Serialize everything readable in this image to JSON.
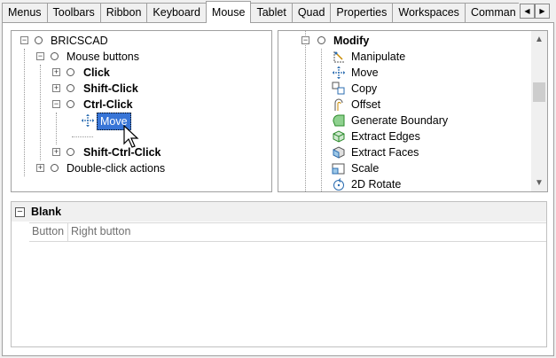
{
  "tabs": [
    "Menus",
    "Toolbars",
    "Ribbon",
    "Keyboard",
    "Mouse",
    "Tablet",
    "Quad",
    "Properties",
    "Workspaces",
    "Comman"
  ],
  "active_tab": "Mouse",
  "tab_scroll": {
    "left": "◀",
    "right": "▶"
  },
  "left_tree": {
    "root": "BRICSCAD",
    "mouse_buttons": "Mouse buttons",
    "click": "Click",
    "shift_click": "Shift-Click",
    "ctrl_click": "Ctrl-Click",
    "move": "Move",
    "shift_ctrl_click": "Shift-Ctrl-Click",
    "double_click": "Double-click actions"
  },
  "right_tree": {
    "group": "Modify",
    "items": [
      "Manipulate",
      "Move",
      "Copy",
      "Offset",
      "Generate Boundary",
      "Extract Edges",
      "Extract Faces",
      "Scale",
      "2D Rotate"
    ]
  },
  "properties": {
    "title": "Blank",
    "columns": [
      "Button",
      "Right button"
    ]
  },
  "colors": {
    "selection": "#3875d7",
    "accent_icon": "#2a8a2a",
    "icon_blue": "#2b6cb0"
  }
}
